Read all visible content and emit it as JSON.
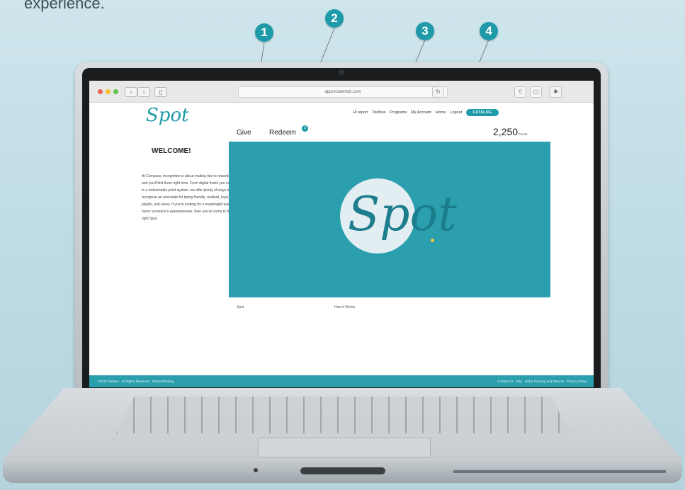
{
  "caption": "experience.",
  "markers": [
    "1",
    "2",
    "3",
    "4"
  ],
  "browser": {
    "url": "appreciatehub.com"
  },
  "page": {
    "logo": "Spot",
    "welcome_title": "WELCOME!",
    "welcome_text": "At Compass, recognition is about making ties to rewards — and you'll find them right here. From digital thank you notes to a redeemable point system, we offer plenty of ways to recognize an associate for being friendly, resilient, loyal, playful, and savvy. If you're looking for a meaningful way to honor someone's awesomeness, then you've come to the right Spot.",
    "top_nav": [
      "HI report",
      "Toolbox",
      "Programs",
      "My Account",
      "Home",
      "Logout"
    ],
    "catalog_button": "CATALOG",
    "tabs": {
      "give": "Give",
      "redeem": "Redeem",
      "redeem_badge": "3"
    },
    "points": {
      "value": "2,250",
      "unit": "Points"
    },
    "hero_logo": "Spot",
    "sub_links": [
      "Spot",
      "How it Works"
    ],
    "footer_left": [
      "©2017 Sodexo",
      "All Rights Reserved",
      "Patent Pending"
    ],
    "footer_right": [
      "Contact Us",
      "Map",
      "Order Tracking and Returns",
      "Privacy Policy"
    ]
  },
  "colors": {
    "accent": "#1f9aa8",
    "hero": "#2b9fae"
  }
}
